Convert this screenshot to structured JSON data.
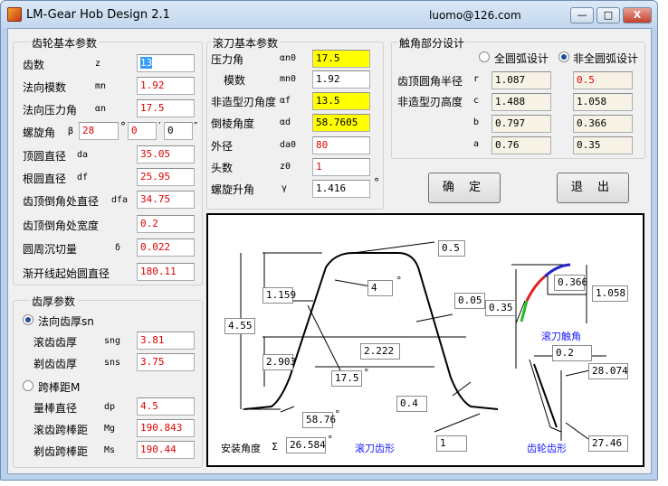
{
  "window": {
    "title": "LM-Gear Hob Design 2.1",
    "email": "luomo@126.com",
    "minimize_label": "—",
    "maximize_label": "□",
    "close_label": "X"
  },
  "gear": {
    "title": "齿轮基本参数",
    "rows": [
      {
        "label": "齿数",
        "sym": "z",
        "value": "13"
      },
      {
        "label": "法向模数",
        "sym": "mn",
        "value": "1.92"
      },
      {
        "label": "法向压力角",
        "sym": "αn",
        "value": "17.5"
      },
      {
        "label": "顶圆直径",
        "sym": "da",
        "value": "35.05"
      },
      {
        "label": "根圆直径",
        "sym": "df",
        "value": "25.95"
      },
      {
        "label": "齿顶倒角处直径",
        "sym": "dfa",
        "value": "34.75"
      },
      {
        "label": "齿顶倒角处宽度",
        "sym": "",
        "value": "0.2"
      },
      {
        "label": "圆周沉切量",
        "sym": "δ",
        "value": "0.022"
      },
      {
        "label": "渐开线起始圆直径",
        "sym": "",
        "value": "180.11"
      }
    ],
    "helix": {
      "label": "螺旋角",
      "sym": "β",
      "deg": "28",
      "min": "0",
      "sec": "0",
      "deg_unit": "°",
      "min_unit": "′",
      "sec_unit": "″"
    }
  },
  "thickness": {
    "title": "齿厚参数",
    "radio_normal": "法向齿厚sn",
    "sng_label": "滚齿齿厚",
    "sng_sym": "sng",
    "sng_value": "3.81",
    "sns_label": "剃齿齿厚",
    "sns_sym": "sns",
    "sns_value": "3.75",
    "radio_pin": "跨棒距M",
    "dp_label": "量棒直径",
    "dp_sym": "dp",
    "dp_value": "4.5",
    "mg_label": "滚齿跨棒距",
    "mg_sym": "Mg",
    "mg_value": "190.843",
    "ms_label": "剃齿跨棒距",
    "ms_sym": "Ms",
    "ms_value": "190.44"
  },
  "hob": {
    "title": "滚刀基本参数",
    "rows": [
      {
        "label": "压力角",
        "sym": "αn0",
        "value": "17.5",
        "style": "yel"
      },
      {
        "label": "模数",
        "sym": "mn0",
        "value": "1.92",
        "style": "plain"
      },
      {
        "label": "非造型刃角度",
        "sym": "αf",
        "value": "13.5",
        "style": "yel"
      },
      {
        "label": "倒棱角度",
        "sym": "αd",
        "value": "58.7605",
        "style": "yel"
      },
      {
        "label": "外径",
        "sym": "da0",
        "value": "80",
        "style": "red"
      },
      {
        "label": "头数",
        "sym": "z0",
        "value": "1",
        "style": "red"
      },
      {
        "label": "螺旋升角",
        "sym": "γ",
        "value": "1.416",
        "style": "plain",
        "unit": "°"
      }
    ]
  },
  "tip": {
    "title": "触角部分设计",
    "radio_full": "全圆弧设计",
    "radio_partial": "非全圆弧设计",
    "tip_radius_label": "齿顶圆角半径",
    "nonshape_height_label": "非造型刃高度",
    "rows": [
      {
        "sym": "r",
        "v1": "1.087",
        "v2": "0.5"
      },
      {
        "sym": "c",
        "v1": "1.488",
        "v2": "1.058"
      },
      {
        "sym": "b",
        "v1": "0.797",
        "v2": "0.366"
      },
      {
        "sym": "a",
        "v1": "0.76",
        "v2": "0.35"
      }
    ]
  },
  "buttons": {
    "ok": "确 定",
    "exit": "退 出"
  },
  "diagram": {
    "hob_values": {
      "top_width": "0.5",
      "tip_angle": "4",
      "chamfer_h": "1.159",
      "total_h": "4.55",
      "pitch_h": "2.903",
      "pitch_w": "2.222",
      "pressure_angle": "17.5",
      "side_gap": "0.05",
      "root_angle": "58.76",
      "bottom_radius": "0.4",
      "bottom_right": "1"
    },
    "tip_values": {
      "b_val": "0.366",
      "c_val": "1.058",
      "a_val": "0.35"
    },
    "gear_values": {
      "width": "0.2",
      "dia1": "28.074",
      "dia2": "27.46"
    },
    "install_label": "安装角度",
    "install_sym": "Σ",
    "install_value": "26.584",
    "deg_unit": "°",
    "cap_hob": "滚刀齿形",
    "cap_tip": "滚刀触角",
    "cap_gear": "齿轮齿形",
    "colors": {
      "caption": "#1a1aff",
      "red": "#e02020",
      "green": "#22bb22",
      "blue": "#2222cc"
    }
  }
}
